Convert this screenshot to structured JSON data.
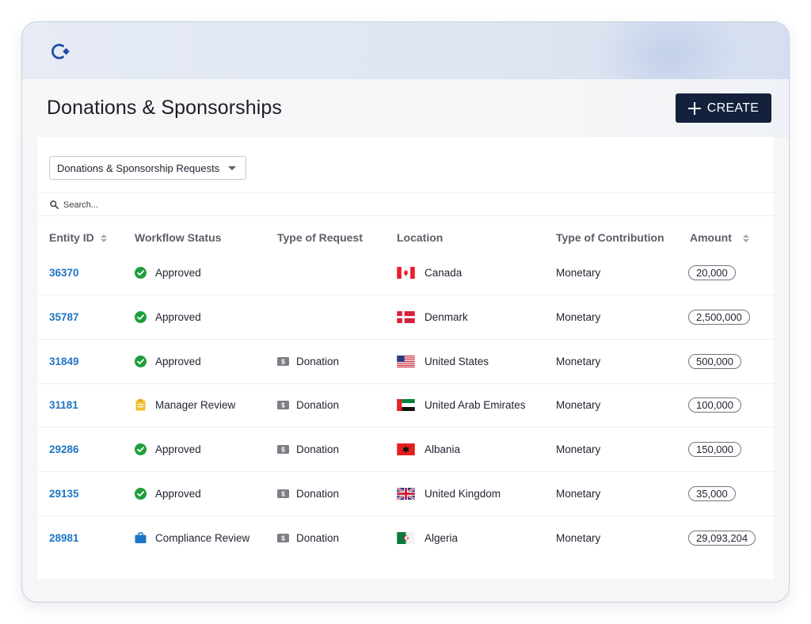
{
  "header": {
    "title": "Donations & Sponsorships",
    "create_label": "CREATE"
  },
  "filters": {
    "view_selected": "Donations & Sponsorship Requests"
  },
  "search": {
    "placeholder": "Search..."
  },
  "table": {
    "columns": {
      "entity_id": "Entity ID",
      "workflow_status": "Workflow Status",
      "type_of_request": "Type of Request",
      "location": "Location",
      "type_of_contribution": "Type of Contribution",
      "amount": "Amount"
    },
    "rows": [
      {
        "entity_id": "36370",
        "status": "Approved",
        "status_icon": "check-circle-icon",
        "request_type": "",
        "location": "Canada",
        "flag_icon": "canada-flag-icon",
        "contribution": "Monetary",
        "amount": "20,000"
      },
      {
        "entity_id": "35787",
        "status": "Approved",
        "status_icon": "check-circle-icon",
        "request_type": "",
        "location": "Denmark",
        "flag_icon": "denmark-flag-icon",
        "contribution": "Monetary",
        "amount": "2,500,000"
      },
      {
        "entity_id": "31849",
        "status": "Approved",
        "status_icon": "check-circle-icon",
        "request_type": "Donation",
        "location": "United States",
        "flag_icon": "usa-flag-icon",
        "contribution": "Monetary",
        "amount": "500,000"
      },
      {
        "entity_id": "31181",
        "status": "Manager Review",
        "status_icon": "clipboard-icon",
        "request_type": "Donation",
        "location": "United Arab Emirates",
        "flag_icon": "uae-flag-icon",
        "contribution": "Monetary",
        "amount": "100,000"
      },
      {
        "entity_id": "29286",
        "status": "Approved",
        "status_icon": "check-circle-icon",
        "request_type": "Donation",
        "location": "Albania",
        "flag_icon": "albania-flag-icon",
        "contribution": "Monetary",
        "amount": "150,000"
      },
      {
        "entity_id": "29135",
        "status": "Approved",
        "status_icon": "check-circle-icon",
        "request_type": "Donation",
        "location": "United Kingdom",
        "flag_icon": "uk-flag-icon",
        "contribution": "Monetary",
        "amount": "35,000"
      },
      {
        "entity_id": "28981",
        "status": "Compliance Review",
        "status_icon": "briefcase-icon",
        "request_type": "Donation",
        "location": "Algeria",
        "flag_icon": "algeria-flag-icon",
        "contribution": "Monetary",
        "amount": "29,093,204"
      }
    ]
  },
  "colors": {
    "brand_navy": "#14213d",
    "link_blue": "#1f75c4",
    "approved_green": "#1e9e3a",
    "review_yellow": "#f2c12e",
    "compliance_blue": "#1f75c4"
  }
}
